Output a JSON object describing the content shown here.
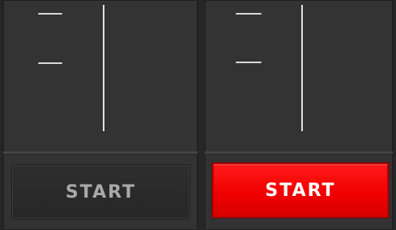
{
  "channels": [
    {
      "id": "channel-1",
      "start_label": "START",
      "active": false
    },
    {
      "id": "channel-2",
      "start_label": "START",
      "active": true
    }
  ],
  "colors": {
    "background": "#333333",
    "tick": "#d9d9d9",
    "fader_line": "#e0e0e0",
    "button_inactive": "#2a2a2a",
    "button_inactive_text": "#a9a9a9",
    "button_active": "#f20000",
    "button_active_text": "#ffffff"
  }
}
